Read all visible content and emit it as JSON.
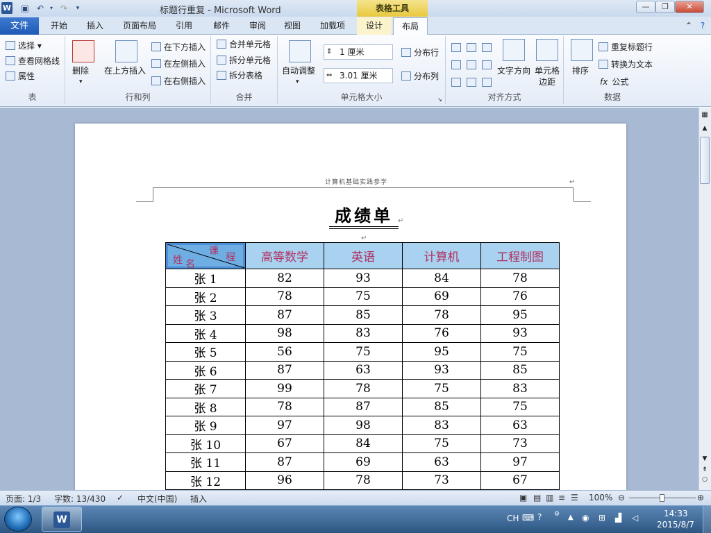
{
  "window": {
    "title": "标题行重复 - Microsoft Word",
    "context_tab": "表格工具",
    "logo": "W"
  },
  "tabs": [
    "文件",
    "开始",
    "插入",
    "页面布局",
    "引用",
    "邮件",
    "审阅",
    "视图",
    "加载项",
    "设计",
    "布局"
  ],
  "ribbon": {
    "table_group": {
      "label": "表",
      "select": "选择",
      "gridlines": "查看网格线",
      "properties": "属性"
    },
    "rows_cols": {
      "label": "行和列",
      "delete": "删除",
      "insert_above": "在上方插入",
      "insert_below": "在下方插入",
      "insert_left": "在左侧插入",
      "insert_right": "在右侧插入"
    },
    "merge": {
      "label": "合并",
      "merge_cells": "合并单元格",
      "split_cells": "拆分单元格",
      "split_table": "拆分表格"
    },
    "cell_size": {
      "label": "单元格大小",
      "autofit": "自动调整",
      "height": "1 厘米",
      "width": "3.01 厘米",
      "dist_rows": "分布行",
      "dist_cols": "分布列"
    },
    "align": {
      "label": "对齐方式",
      "text_dir": "文字方向",
      "margins": "单元格边距"
    },
    "data": {
      "label": "数据",
      "sort": "排序",
      "repeat_header": "重复标题行",
      "convert": "转换为文本",
      "formula": "公式"
    }
  },
  "document": {
    "header_text": "计算机基础实践参学",
    "title": "成绩单",
    "corner": {
      "course": "课",
      "cheng": "程",
      "name1": "姓",
      "name2": "名"
    },
    "columns": [
      "高等数学",
      "英语",
      "计算机",
      "工程制图"
    ],
    "rows": [
      {
        "name": "张 1",
        "scores": [
          "82",
          "93",
          "84",
          "78"
        ]
      },
      {
        "name": "张 2",
        "scores": [
          "78",
          "75",
          "69",
          "76"
        ]
      },
      {
        "name": "张 3",
        "scores": [
          "87",
          "85",
          "78",
          "95"
        ]
      },
      {
        "name": "张 4",
        "scores": [
          "98",
          "83",
          "76",
          "93"
        ]
      },
      {
        "name": "张 5",
        "scores": [
          "56",
          "75",
          "95",
          "75"
        ]
      },
      {
        "name": "张 6",
        "scores": [
          "87",
          "63",
          "93",
          "85"
        ]
      },
      {
        "name": "张 7",
        "scores": [
          "99",
          "78",
          "75",
          "83"
        ]
      },
      {
        "name": "张 8",
        "scores": [
          "78",
          "87",
          "85",
          "75"
        ]
      },
      {
        "name": "张 9",
        "scores": [
          "97",
          "98",
          "83",
          "63"
        ]
      },
      {
        "name": "张 10",
        "scores": [
          "67",
          "84",
          "75",
          "73"
        ]
      },
      {
        "name": "张 11",
        "scores": [
          "87",
          "69",
          "63",
          "97"
        ]
      },
      {
        "name": "张 12",
        "scores": [
          "96",
          "78",
          "73",
          "67"
        ]
      }
    ]
  },
  "status": {
    "page": "页面: 1/3",
    "words": "字数: 13/430",
    "lang": "中文(中国)",
    "mode": "插入",
    "zoom": "100%"
  },
  "taskbar": {
    "lang": "CH",
    "time": "14:33",
    "date": "2015/8/7"
  },
  "colors": {
    "header_fill": "#a9d1f0",
    "header_text": "#b03060",
    "file_tab": "#2b5797"
  }
}
